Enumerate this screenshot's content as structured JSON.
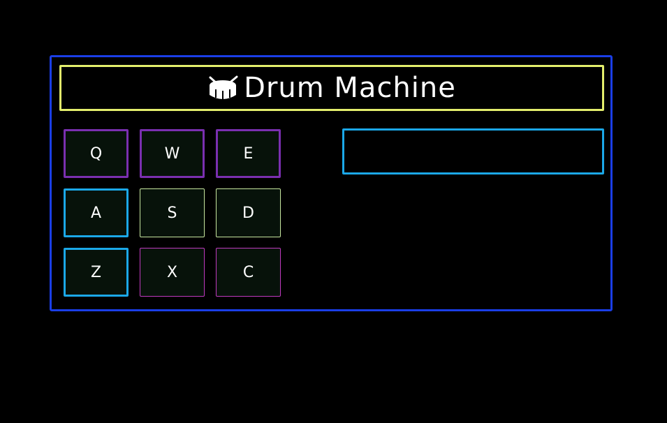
{
  "app": {
    "title": "Drum Machine"
  },
  "pads": [
    {
      "key": "Q",
      "border": "#7a2fb0",
      "width": "thick"
    },
    {
      "key": "W",
      "border": "#7a2fb0",
      "width": "thick"
    },
    {
      "key": "E",
      "border": "#7a2fb0",
      "width": "thick"
    },
    {
      "key": "A",
      "border": "#1ba8e8",
      "width": "thick"
    },
    {
      "key": "S",
      "border": "#c8e8a0",
      "width": "thin"
    },
    {
      "key": "D",
      "border": "#c8e8a0",
      "width": "thin"
    },
    {
      "key": "Z",
      "border": "#1ba8e8",
      "width": "thick"
    },
    {
      "key": "X",
      "border": "#c03ac0",
      "width": "thin"
    },
    {
      "key": "C",
      "border": "#c03ac0",
      "width": "thin"
    }
  ],
  "display": {
    "text": ""
  },
  "colors": {
    "background": "#000000",
    "frame": "#1a3ee6",
    "title_border": "#e3ee6c",
    "display_border": "#1ba8e8",
    "pad_fill": "#07120a"
  },
  "icons": {
    "title_icon": "drum-icon"
  }
}
